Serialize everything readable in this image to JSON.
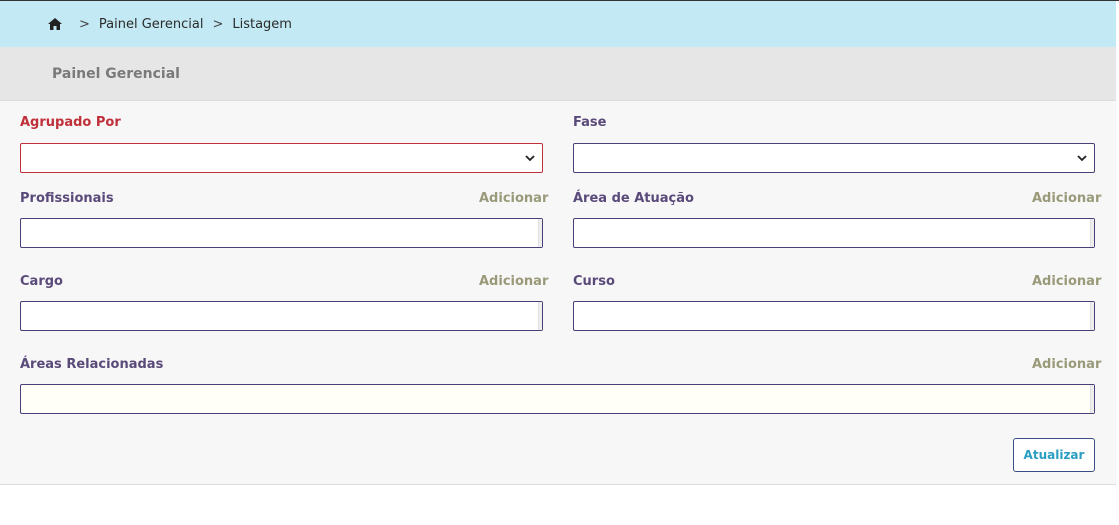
{
  "breadcrumb": {
    "home_icon": "home-icon",
    "separator": ">",
    "items": [
      "Painel Gerencial",
      "Listagem"
    ]
  },
  "header": {
    "title": "Painel Gerencial"
  },
  "form": {
    "agrupado_por": {
      "label": "Agrupado Por",
      "value": ""
    },
    "fase": {
      "label": "Fase",
      "value": ""
    },
    "profissionais": {
      "label": "Profissionais",
      "add": "Adicionar",
      "value": ""
    },
    "area_atuacao": {
      "label": "Área de Atuação",
      "add": "Adicionar",
      "value": ""
    },
    "cargo": {
      "label": "Cargo",
      "add": "Adicionar",
      "value": ""
    },
    "curso": {
      "label": "Curso",
      "add": "Adicionar",
      "value": ""
    },
    "areas_relacionadas": {
      "label": "Áreas Relacionadas",
      "add": "Adicionar",
      "value": ""
    },
    "update_label": "Atualizar"
  },
  "colors": {
    "breadcrumb_bg": "#c3e9f4",
    "required": "#c0303a",
    "label": "#5a4a7a",
    "add_link": "#9a9a7a",
    "button_text": "#2a9ec2"
  }
}
